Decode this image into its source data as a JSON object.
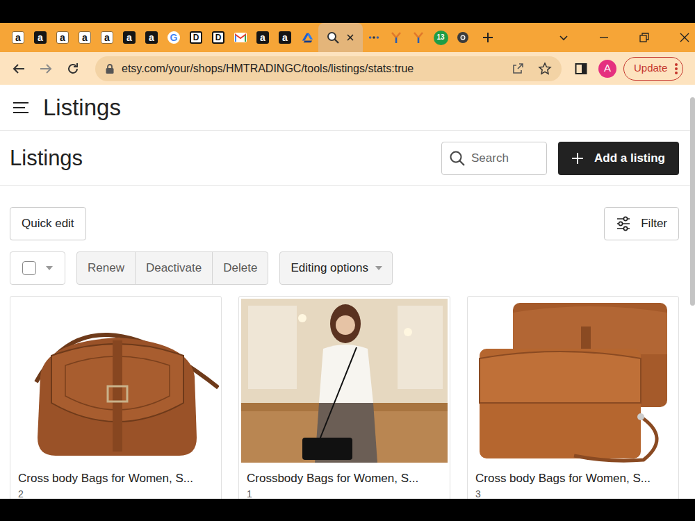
{
  "browser": {
    "tabs": [
      {
        "kind": "amazon-light",
        "glyph": "a",
        "selected": false
      },
      {
        "kind": "amazon-dark",
        "glyph": "a",
        "selected": false
      },
      {
        "kind": "amazon-light",
        "glyph": "a",
        "selected": false
      },
      {
        "kind": "amazon-light",
        "glyph": "a",
        "selected": false
      },
      {
        "kind": "amazon-light",
        "glyph": "a",
        "selected": false
      },
      {
        "kind": "amazon-dark",
        "glyph": "a",
        "selected": false
      },
      {
        "kind": "amazon-dark",
        "glyph": "a",
        "selected": false
      },
      {
        "kind": "google",
        "glyph": "G",
        "selected": false
      },
      {
        "kind": "doc",
        "glyph": "D",
        "selected": false
      },
      {
        "kind": "doc",
        "glyph": "D",
        "selected": false
      },
      {
        "kind": "gmail",
        "selected": false
      },
      {
        "kind": "amazon-dark",
        "glyph": "a",
        "selected": false
      },
      {
        "kind": "amazon-dark",
        "glyph": "a",
        "selected": false
      },
      {
        "kind": "drive",
        "selected": false
      },
      {
        "kind": "search",
        "selected": true
      },
      {
        "kind": "dots",
        "selected": false
      },
      {
        "kind": "fork",
        "selected": false
      },
      {
        "kind": "fork",
        "selected": false
      },
      {
        "kind": "count",
        "glyph": "13",
        "selected": false
      },
      {
        "kind": "chrome",
        "selected": false
      }
    ],
    "url": "etsy.com/your/shops/HMTRADINGC/tools/listings/stats:true",
    "profile": "A",
    "update": "Update"
  },
  "page": {
    "header": {
      "title": "Listings"
    },
    "toolbar": {
      "title": "Listings",
      "search": {
        "placeholder": "Search"
      },
      "add_button": "Add a listing"
    },
    "actions": {
      "quick_edit": "Quick edit",
      "filter": "Filter",
      "select_all": {
        "checked": false
      },
      "bulk": [
        {
          "label": "Renew",
          "disabled": true
        },
        {
          "label": "Deactivate",
          "disabled": true
        },
        {
          "label": "Delete",
          "disabled": true
        }
      ],
      "editing_options": {
        "label": "Editing options",
        "disabled": true
      }
    },
    "listings": [
      {
        "title": "Cross body Bags for Women, S...",
        "stock": "2",
        "kind": "saddle"
      },
      {
        "title": "Crossbody Bags for Women, S...",
        "stock": "1",
        "kind": "model"
      },
      {
        "title": "Cross body Bags for Women, S...",
        "stock": "3",
        "kind": "flap"
      }
    ]
  }
}
